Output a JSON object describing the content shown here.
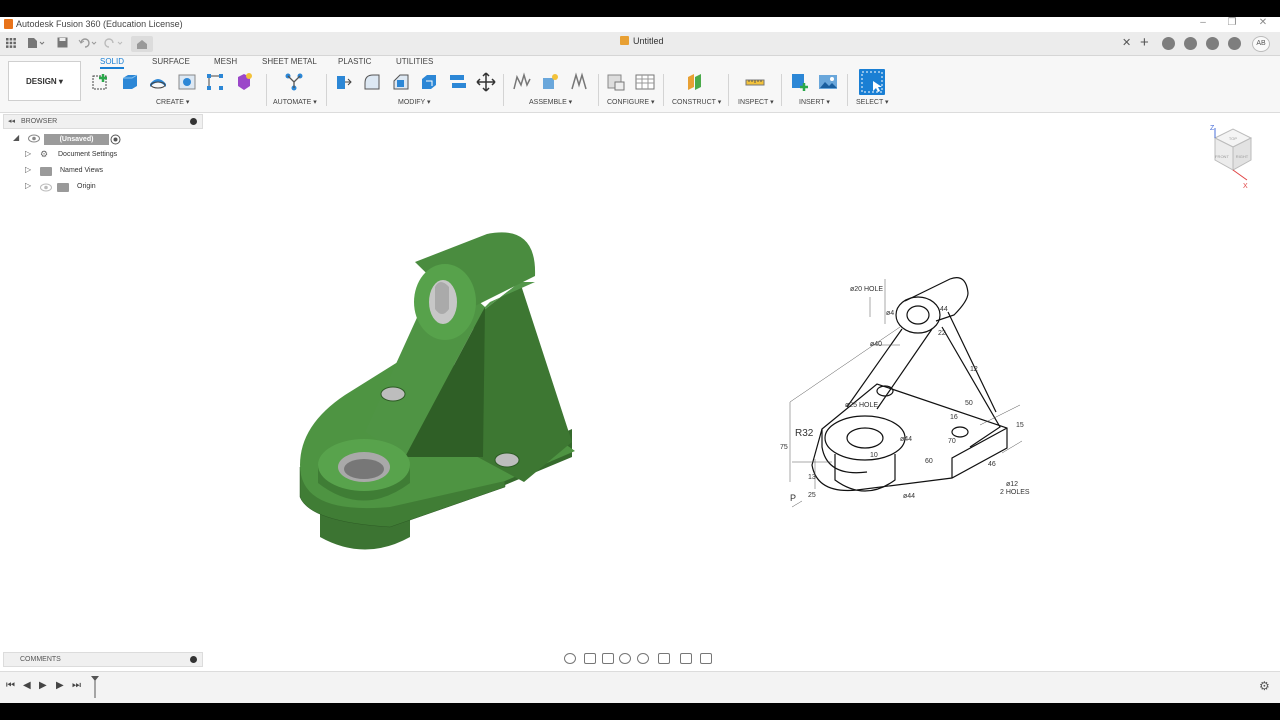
{
  "window": {
    "title": "Autodesk Fusion 360 (Education License)",
    "controls": {
      "minimize": "–",
      "restore": "❐",
      "close": "✕"
    }
  },
  "tabbar": {
    "doc_title": "Untitled",
    "close": "✕",
    "plus": "+",
    "avatar_initials": "AB"
  },
  "workspace": {
    "label": "DESIGN ▾"
  },
  "toolbar_tabs": [
    "SOLID",
    "SURFACE",
    "MESH",
    "SHEET METAL",
    "PLASTIC",
    "UTILITIES"
  ],
  "active_tab": "SOLID",
  "groups": {
    "create": "CREATE ▾",
    "automate": "AUTOMATE ▾",
    "modify": "MODIFY ▾",
    "assemble": "ASSEMBLE ▾",
    "configure": "CONFIGURE ▾",
    "construct": "CONSTRUCT ▾",
    "inspect": "INSPECT ▾",
    "insert": "INSERT ▾",
    "select": "SELECT ▾"
  },
  "browser": {
    "title": "BROWSER",
    "root": "(Unsaved)",
    "items": [
      "Document Settings",
      "Named Views",
      "Origin"
    ]
  },
  "comments": {
    "title": "COMMENTS"
  },
  "viewcube": {
    "top": "TOP",
    "front": "FRONT",
    "right": "RIGHT",
    "axis_x": "X",
    "axis_z": "Z"
  },
  "drawing": {
    "labels": {
      "hole20": "ø20  HOLE",
      "d4": "ø4",
      "d40": "ø40",
      "d44top": "44",
      "d22": "22",
      "d12a": "12",
      "d50": "50",
      "d25hole": "ø25  HOLE",
      "r32": "R32",
      "d75": "75",
      "d44mid": "ø44",
      "d10": "10",
      "d15": "15",
      "d44b": "ø44",
      "d12b": "ø12",
      "holes2": "2  HOLES",
      "p": "P",
      "d25": "25",
      "d13": "13",
      "d46": "46",
      "d16": "16",
      "d60": "60",
      "d70": "70"
    }
  }
}
